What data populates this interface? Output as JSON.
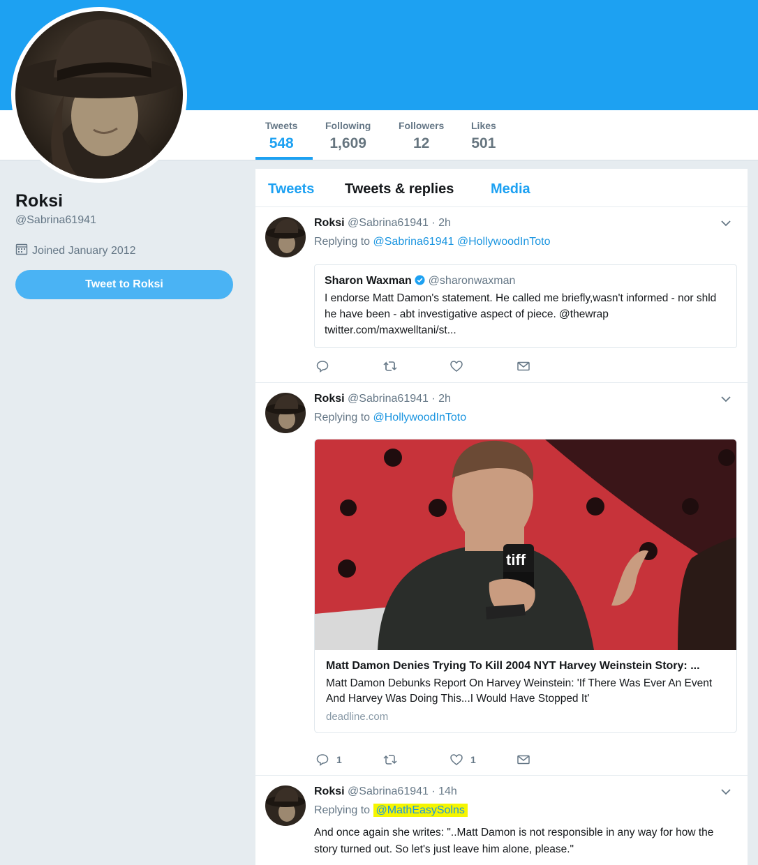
{
  "profile": {
    "name": "Roksi",
    "handle": "@Sabrina61941",
    "joined": "Joined January 2012",
    "tweet_to_label": "Tweet to Roksi"
  },
  "stats": [
    {
      "label": "Tweets",
      "value": "548"
    },
    {
      "label": "Following",
      "value": "1,609"
    },
    {
      "label": "Followers",
      "value": "12"
    },
    {
      "label": "Likes",
      "value": "501"
    }
  ],
  "tabs": [
    "Tweets",
    "Tweets & replies",
    "Media"
  ],
  "tweets": [
    {
      "name": "Roksi",
      "meta": "@Sabrina61941 · 2h",
      "replying_to_label": "Replying to",
      "mentions": [
        "@Sabrina61941",
        "@HollywoodInToto"
      ],
      "quote": {
        "name": "Sharon Waxman",
        "handle": "@sharonwaxman",
        "text": "I endorse Matt Damon's statement. He called me briefly,wasn't informed - nor shld he have been - abt investigative aspect of piece. @thewrap twitter.com/maxwelltani/st..."
      }
    },
    {
      "name": "Roksi",
      "meta": "@Sabrina61941 · 2h",
      "replying_to_label": "Replying to",
      "mentions": [
        "@HollywoodInToto"
      ],
      "card": {
        "title": "Matt Damon Denies Trying To Kill 2004 NYT Harvey Weinstein Story: ...",
        "description": "Matt Damon Debunks Report On Harvey Weinstein: 'If There Was Ever An Event And Harvey Was Doing This...I Would Have Stopped It'",
        "domain": "deadline.com",
        "image_badge": "tiff"
      },
      "reply_count": "1",
      "like_count": "1"
    },
    {
      "name": "Roksi",
      "meta": "@Sabrina61941 · 14h",
      "replying_to_label": "Replying to",
      "mentions": [
        "@MathEasySolns"
      ],
      "text": "And once again she writes: \"..Matt Damon is not responsible in any way for how the story turned out. So let's just leave him alone, please.\""
    }
  ],
  "colors": {
    "brand": "#1da1f2",
    "highlight": "#f5f500",
    "background": "#e6ecf0"
  }
}
